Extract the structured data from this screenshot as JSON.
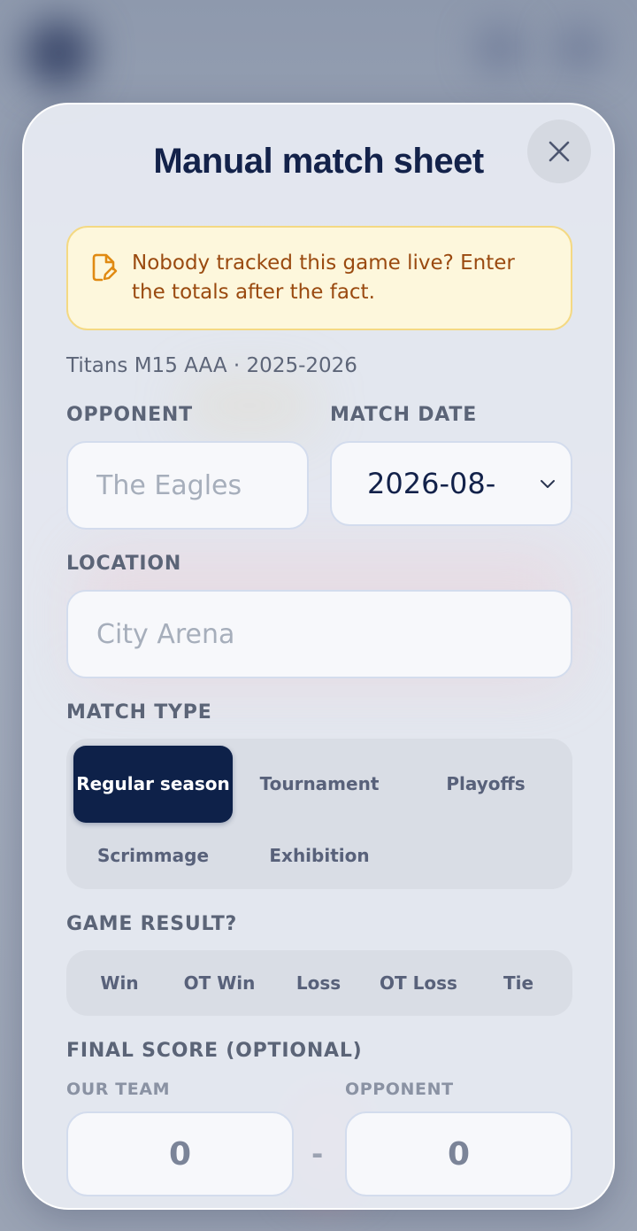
{
  "modal": {
    "title": "Manual match sheet",
    "notice": "Nobody tracked this game live? Enter the totals after the fact.",
    "subtitle": "Titans M15 AAA · 2025-2026"
  },
  "opponent": {
    "label": "OPPONENT",
    "placeholder": "The Eagles"
  },
  "match_date": {
    "label": "MATCH DATE",
    "value": "2026-08-"
  },
  "location": {
    "label": "LOCATION",
    "placeholder": "City Arena"
  },
  "match_type": {
    "label": "MATCH TYPE",
    "options": [
      "Regular season",
      "Tournament",
      "Playoffs",
      "Scrimmage",
      "Exhibition"
    ],
    "selected": "Regular season"
  },
  "game_result": {
    "label": "GAME RESULT?",
    "options": [
      "Win",
      "OT Win",
      "Loss",
      "OT Loss",
      "Tie"
    ]
  },
  "final_score": {
    "label": "FINAL SCORE (OPTIONAL)",
    "our_team_label": "OUR TEAM",
    "opponent_label": "OPPONENT",
    "our_team_value": "0",
    "opponent_value": "0",
    "separator": "-"
  },
  "colors": {
    "accent_navy": "#0e2149",
    "notice_bg": "#fdf7dc",
    "notice_text": "#9a4a10"
  },
  "icons": {
    "close": "close-icon",
    "notice": "edit-document-icon",
    "date_dropdown": "chevron-down-icon"
  }
}
